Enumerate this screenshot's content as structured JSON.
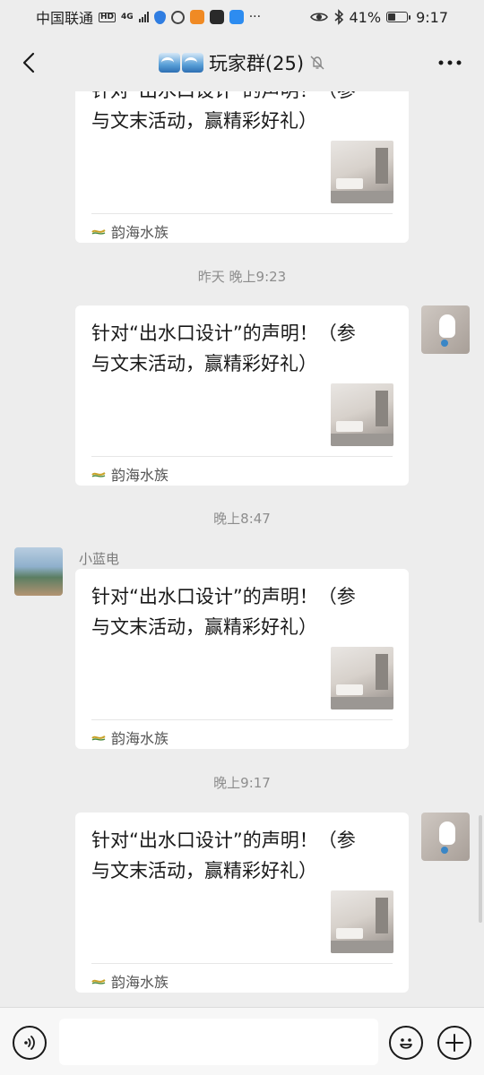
{
  "status_bar": {
    "carrier": "中国联通",
    "network_badges": [
      "HD",
      "4G"
    ],
    "overflow": "···",
    "battery_percent": "41%",
    "battery_level": 0.41,
    "time": "9:17",
    "icons": [
      "hd-icon",
      "signal-icon",
      "shield-icon",
      "circle-icon",
      "play-icon",
      "mail-icon",
      "cloud-icon",
      "eye-icon",
      "bluetooth-icon",
      "battery-icon"
    ]
  },
  "nav": {
    "title": "玩家群(25)",
    "title_emoji": "🌊🌊",
    "icons": [
      "back-icon",
      "mute-icon",
      "more-icon"
    ]
  },
  "messages": [
    {
      "type": "card",
      "title": "针对“出水口设计”的声明！（参与文末活动，赢精彩好礼）",
      "source": "韵海水族",
      "sender": "me"
    },
    {
      "type": "time",
      "text": "昨天 晚上9:23"
    },
    {
      "type": "card",
      "title": "针对“出水口设计”的声明！（参与文末活动，赢精彩好礼）",
      "source": "韵海水族",
      "sender": "me"
    },
    {
      "type": "time",
      "text": "晚上8:47"
    },
    {
      "type": "card",
      "title": "针对“出水口设计”的声明！（参与文末活动，赢精彩好礼）",
      "source": "韵海水族",
      "sender": "other",
      "sender_name": "小蓝电"
    },
    {
      "type": "time",
      "text": "晚上9:17"
    },
    {
      "type": "card",
      "title": "针对“出水口设计”的声明！（参与文末活动，赢精彩好礼）",
      "source": "韵海水族",
      "sender": "me"
    }
  ],
  "card_lines": [
    "针对“出水口设计”的声明！（参",
    "与文末活动，赢精彩好礼）"
  ],
  "input_bar": {
    "value": "",
    "icons": [
      "voice-icon",
      "emoji-icon",
      "plus-icon"
    ]
  },
  "colors": {
    "background": "#ededed",
    "card": "#ffffff",
    "input_bar": "#f7f7f7",
    "time_text": "#8d8d8d"
  }
}
